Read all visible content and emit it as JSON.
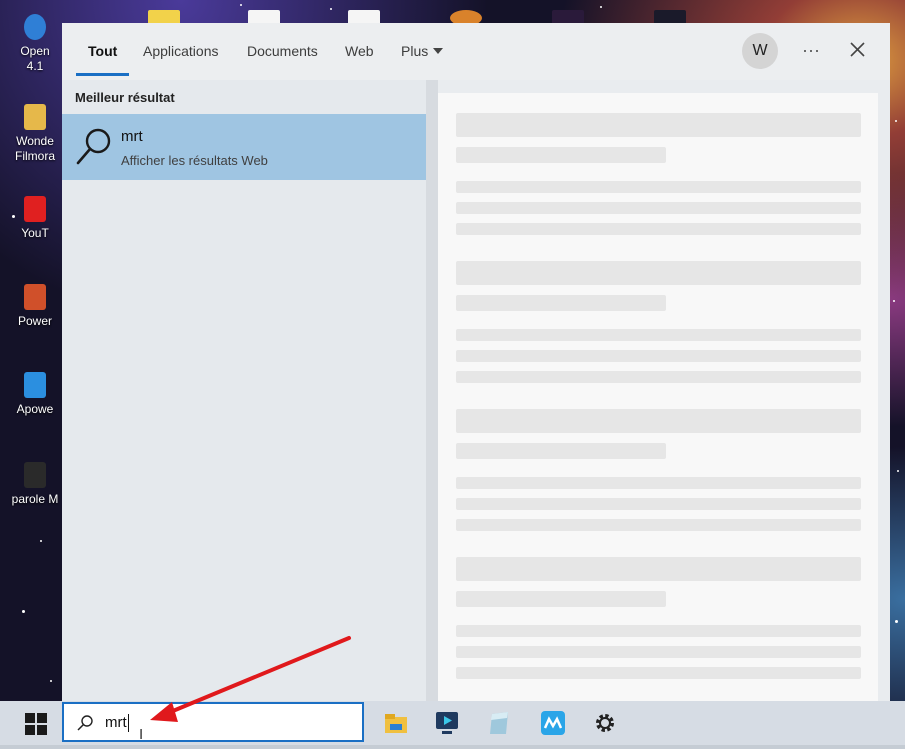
{
  "desktop": {
    "icons": [
      {
        "label": "Open",
        "label2": "4.1"
      },
      {
        "label": "Wonde",
        "label2": "Filmora"
      },
      {
        "label": "YouT"
      },
      {
        "label": "Power"
      },
      {
        "label": "Apowe"
      },
      {
        "label": "parole M"
      }
    ]
  },
  "search_panel": {
    "tabs": [
      {
        "label": "Tout",
        "active": true
      },
      {
        "label": "Applications"
      },
      {
        "label": "Documents"
      },
      {
        "label": "Web"
      },
      {
        "label": "Plus"
      }
    ],
    "avatar_letter": "W",
    "more_label": "···",
    "best_result_label": "Meilleur résultat",
    "best_result": {
      "title": "mrt",
      "subtitle": "Afficher les résultats Web",
      "icon": "search-icon"
    },
    "preview_state": "loading-skeleton"
  },
  "taskbar": {
    "search_value": "mrt",
    "pinned_apps": [
      "file-explorer-icon",
      "screen-recorder-icon",
      "notes-app-icon",
      "movavi-icon",
      "settings-gear-icon"
    ]
  },
  "annotation": {
    "arrow_color": "#e0191c"
  },
  "colors": {
    "accent": "#1a6fc4",
    "selected_result": "#9fc5e2"
  }
}
